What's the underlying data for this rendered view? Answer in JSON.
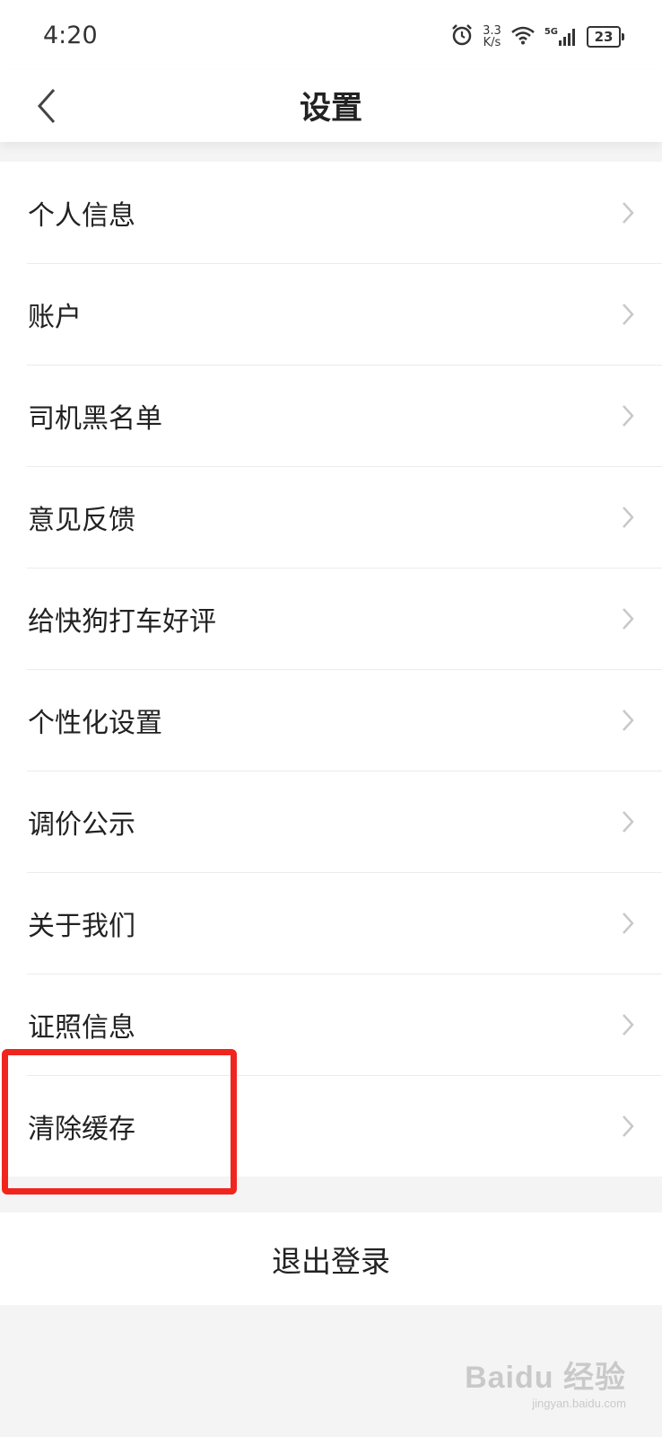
{
  "status_bar": {
    "time": "4:20",
    "net_speed_value": "3.3",
    "net_speed_unit": "K/s",
    "network_type": "5G",
    "battery": "23"
  },
  "navbar": {
    "title": "设置"
  },
  "menu": {
    "items": [
      {
        "label": "个人信息"
      },
      {
        "label": "账户"
      },
      {
        "label": "司机黑名单"
      },
      {
        "label": "意见反馈"
      },
      {
        "label": "给快狗打车好评"
      },
      {
        "label": "个性化设置"
      },
      {
        "label": "调价公示"
      },
      {
        "label": "关于我们"
      },
      {
        "label": "证照信息"
      },
      {
        "label": "清除缓存"
      }
    ]
  },
  "logout": {
    "label": "退出登录"
  },
  "watermark": {
    "logo": "Baidu 经验",
    "url": "jingyan.baidu.com"
  },
  "colors": {
    "highlight": "#f0261e",
    "background": "#f4f4f4",
    "card": "#ffffff"
  }
}
